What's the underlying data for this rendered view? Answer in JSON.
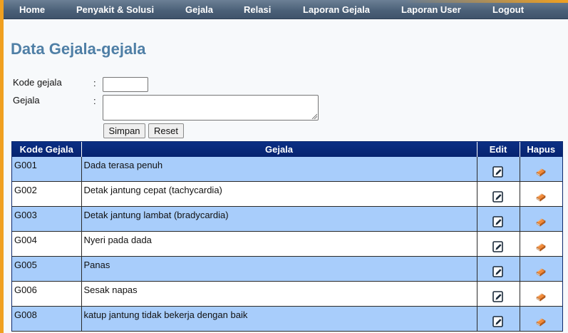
{
  "nav": {
    "items": [
      {
        "label": "Home"
      },
      {
        "label": "Penyakit & Solusi"
      },
      {
        "label": "Gejala"
      },
      {
        "label": "Relasi"
      },
      {
        "label": "Laporan Gejala"
      },
      {
        "label": "Laporan User"
      },
      {
        "label": "Logout"
      }
    ]
  },
  "page": {
    "title": "Data Gejala-gejala"
  },
  "form": {
    "kode_label": "Kode gejala",
    "gejala_label": "Gejala",
    "colon": ":",
    "kode_value": "",
    "gejala_value": "",
    "save_label": "Simpan",
    "reset_label": "Reset"
  },
  "table": {
    "headers": {
      "kode": "Kode Gejala",
      "gejala": "Gejala",
      "edit": "Edit",
      "hapus": "Hapus"
    },
    "rows": [
      {
        "kode": "G001",
        "gejala": "Dada terasa penuh"
      },
      {
        "kode": "G002",
        "gejala": "Detak jantung cepat (tachycardia)"
      },
      {
        "kode": "G003",
        "gejala": "Detak jantung lambat (bradycardia)"
      },
      {
        "kode": "G004",
        "gejala": "Nyeri pada dada"
      },
      {
        "kode": "G005",
        "gejala": "Panas"
      },
      {
        "kode": "G006",
        "gejala": "Sesak napas"
      },
      {
        "kode": "G008",
        "gejala": "katup jantung tidak bekerja dengan baik"
      }
    ]
  },
  "icons": {
    "edit": "edit-pencil-icon",
    "delete": "eraser-icon"
  },
  "colors": {
    "title": "#4f7fa6",
    "header": "#0b2f85",
    "row_alt": "#a8cdfb",
    "navbar": "#4a5f77",
    "accent": "#f0a020"
  }
}
